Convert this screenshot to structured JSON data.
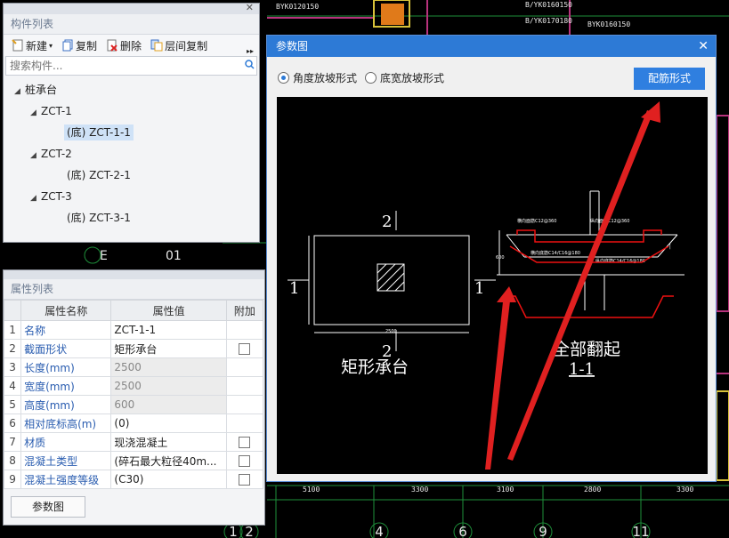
{
  "cad_background": {
    "labels": [
      "BYK0120150",
      "B/YK0160150",
      "B/YK0170180",
      "BYK0160150",
      "E",
      "01",
      "5100",
      "3300",
      "3100",
      "2800",
      "3300"
    ],
    "grid_numbers": [
      "1",
      "2",
      "4",
      "6",
      "9",
      "11"
    ]
  },
  "component_panel": {
    "title": "构件列表",
    "toolbar": {
      "new_label": "新建",
      "copy_label": "复制",
      "delete_label": "删除",
      "floor_copy_label": "层间复制"
    },
    "search_placeholder": "搜索构件...",
    "tree": {
      "root": "桩承台",
      "groups": [
        {
          "name": "ZCT-1",
          "child": "(底) ZCT-1-1"
        },
        {
          "name": "ZCT-2",
          "child": "(底) ZCT-2-1"
        },
        {
          "name": "ZCT-3",
          "child": "(底) ZCT-3-1"
        }
      ]
    }
  },
  "property_panel": {
    "title": "属性列表",
    "headers": {
      "name": "属性名称",
      "value": "属性值",
      "extra": "附加"
    },
    "rows": [
      {
        "num": "1",
        "name": "名称",
        "value": "ZCT-1-1"
      },
      {
        "num": "2",
        "name": "截面形状",
        "value": "矩形承台"
      },
      {
        "num": "3",
        "name": "长度(mm)",
        "value": "2500"
      },
      {
        "num": "4",
        "name": "宽度(mm)",
        "value": "2500"
      },
      {
        "num": "5",
        "name": "高度(mm)",
        "value": "600"
      },
      {
        "num": "6",
        "name": "相对底标高(m)",
        "value": "(0)"
      },
      {
        "num": "7",
        "name": "材质",
        "value": "现浇混凝土"
      },
      {
        "num": "8",
        "name": "混凝土类型",
        "value": "(碎石最大粒径40m..."
      },
      {
        "num": "9",
        "name": "混凝土强度等级",
        "value": "(C30)"
      }
    ],
    "param_button_label": "参数图"
  },
  "param_dialog": {
    "title": "参数图",
    "radio_angle_label": "角度放坡形式",
    "radio_width_label": "底宽放坡形式",
    "rebar_button_label": "配筋形式",
    "drawing": {
      "plan_caption": "矩形承台",
      "section_caption": "全部翻起",
      "section_label": "1-1",
      "mark_2": "2",
      "mark_1": "1",
      "dim_2500": "2500",
      "dim_600": "600",
      "rebar_labels": [
        "横向面筋C12@360",
        "纵向面筋C12@360",
        "横向底筋C14/C16@180",
        "纵向底筋C14/C16@180"
      ]
    }
  }
}
